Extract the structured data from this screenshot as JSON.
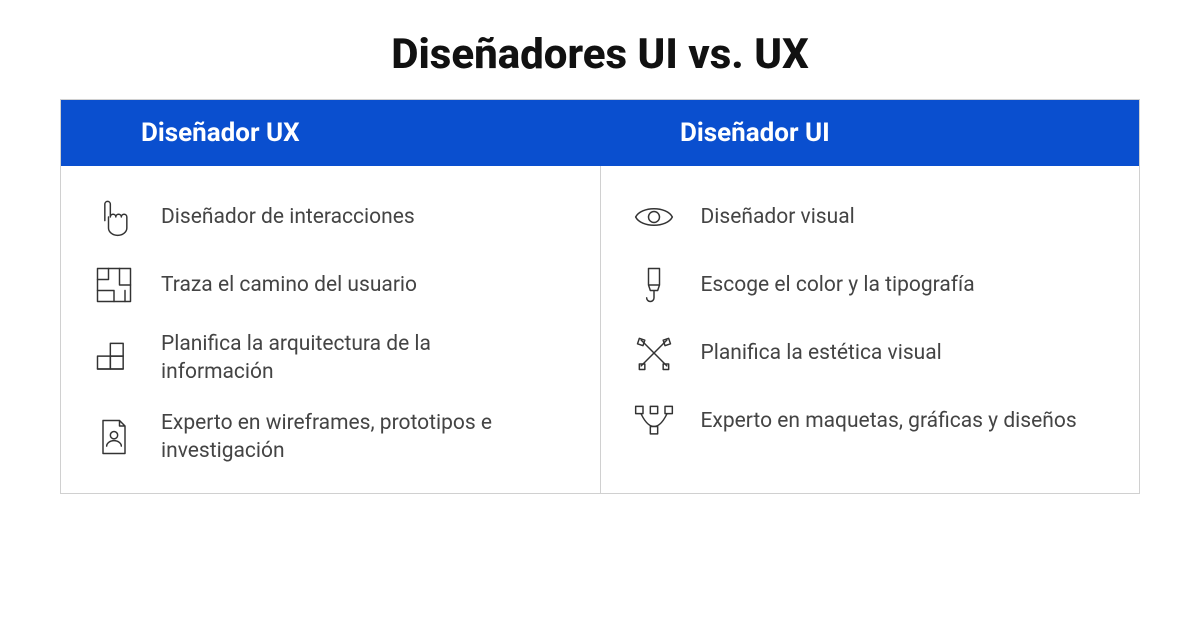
{
  "title": "Diseñadores UI vs. UX",
  "columns": {
    "ux": {
      "header": "Diseñador UX",
      "items": [
        {
          "icon": "pointer-icon",
          "text": "Diseñador de interacciones"
        },
        {
          "icon": "maze-icon",
          "text": "Traza el camino del usuario"
        },
        {
          "icon": "blocks-icon",
          "text": "Planifica la arquitectura de la información"
        },
        {
          "icon": "profile-doc-icon",
          "text": "Experto en wireframes, prototipos e investigación"
        }
      ]
    },
    "ui": {
      "header": "Diseñador UI",
      "items": [
        {
          "icon": "eye-icon",
          "text": "Diseñador visual"
        },
        {
          "icon": "brush-icon",
          "text": "Escoge el color y la tipografía"
        },
        {
          "icon": "tools-icon",
          "text": "Planifica la estética visual"
        },
        {
          "icon": "vector-icon",
          "text": "Experto en maquetas, gráficas y diseños"
        }
      ]
    }
  }
}
